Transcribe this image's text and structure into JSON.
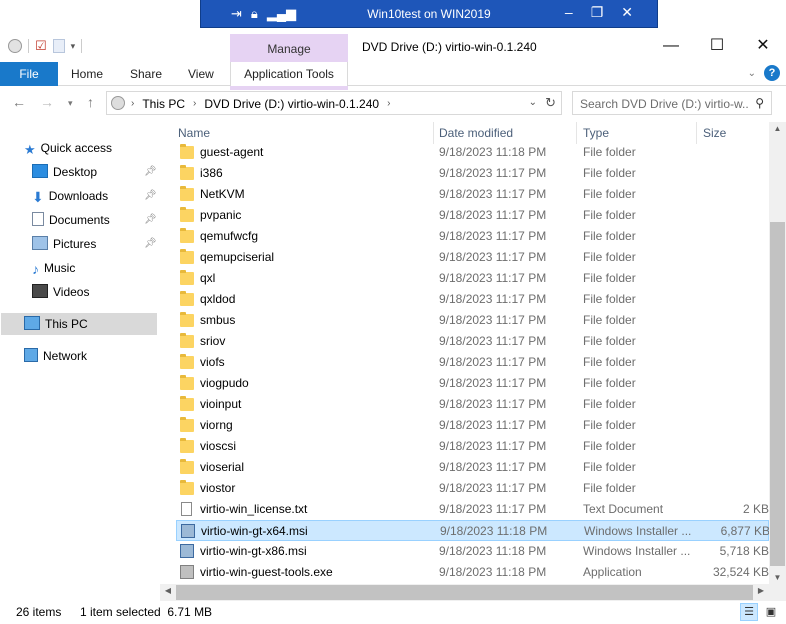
{
  "rdp": {
    "title": "Win10test on WIN2019",
    "icons": [
      "pin-icon",
      "lock-icon",
      "signal-icon"
    ],
    "controls": [
      "minimize-icon",
      "restore-icon",
      "close-icon"
    ]
  },
  "window": {
    "title": "DVD Drive (D:) virtio-win-0.1.240",
    "context_tab_group": "Manage",
    "controls": [
      "minimize-icon",
      "maximize-icon",
      "close-icon"
    ]
  },
  "ribbon": {
    "tabs": [
      "File",
      "Home",
      "Share",
      "View",
      "Application Tools"
    ],
    "help": "?",
    "file_color": "#1979ca",
    "manage_color": "#e6d3f3"
  },
  "address": {
    "crumbs": [
      "This PC",
      "DVD Drive (D:) virtio-win-0.1.240"
    ],
    "search_placeholder": "Search DVD Drive (D:) virtio-w..."
  },
  "nav": {
    "items": [
      {
        "label": "Quick access",
        "icon": "star-icon"
      },
      {
        "label": "Desktop",
        "icon": "desktop-icon",
        "pinned": true
      },
      {
        "label": "Downloads",
        "icon": "download-icon",
        "pinned": true
      },
      {
        "label": "Documents",
        "icon": "documents-icon",
        "pinned": true
      },
      {
        "label": "Pictures",
        "icon": "pictures-icon",
        "pinned": true
      },
      {
        "label": "Music",
        "icon": "music-icon"
      },
      {
        "label": "Videos",
        "icon": "videos-icon"
      },
      {
        "label": "This PC",
        "icon": "computer-icon",
        "selected": true
      },
      {
        "label": "Network",
        "icon": "network-icon"
      }
    ]
  },
  "columns": {
    "name": "Name",
    "date": "Date modified",
    "type": "Type",
    "size": "Size"
  },
  "files": [
    {
      "name": "guest-agent",
      "date": "9/18/2023 11:18 PM",
      "type": "File folder",
      "size": "",
      "icon": "folder"
    },
    {
      "name": "i386",
      "date": "9/18/2023 11:17 PM",
      "type": "File folder",
      "size": "",
      "icon": "folder"
    },
    {
      "name": "NetKVM",
      "date": "9/18/2023 11:17 PM",
      "type": "File folder",
      "size": "",
      "icon": "folder"
    },
    {
      "name": "pvpanic",
      "date": "9/18/2023 11:17 PM",
      "type": "File folder",
      "size": "",
      "icon": "folder"
    },
    {
      "name": "qemufwcfg",
      "date": "9/18/2023 11:17 PM",
      "type": "File folder",
      "size": "",
      "icon": "folder"
    },
    {
      "name": "qemupciserial",
      "date": "9/18/2023 11:17 PM",
      "type": "File folder",
      "size": "",
      "icon": "folder"
    },
    {
      "name": "qxl",
      "date": "9/18/2023 11:17 PM",
      "type": "File folder",
      "size": "",
      "icon": "folder"
    },
    {
      "name": "qxldod",
      "date": "9/18/2023 11:17 PM",
      "type": "File folder",
      "size": "",
      "icon": "folder"
    },
    {
      "name": "smbus",
      "date": "9/18/2023 11:17 PM",
      "type": "File folder",
      "size": "",
      "icon": "folder"
    },
    {
      "name": "sriov",
      "date": "9/18/2023 11:17 PM",
      "type": "File folder",
      "size": "",
      "icon": "folder"
    },
    {
      "name": "viofs",
      "date": "9/18/2023 11:17 PM",
      "type": "File folder",
      "size": "",
      "icon": "folder"
    },
    {
      "name": "viogpudo",
      "date": "9/18/2023 11:17 PM",
      "type": "File folder",
      "size": "",
      "icon": "folder"
    },
    {
      "name": "vioinput",
      "date": "9/18/2023 11:17 PM",
      "type": "File folder",
      "size": "",
      "icon": "folder"
    },
    {
      "name": "viorng",
      "date": "9/18/2023 11:17 PM",
      "type": "File folder",
      "size": "",
      "icon": "folder"
    },
    {
      "name": "vioscsi",
      "date": "9/18/2023 11:17 PM",
      "type": "File folder",
      "size": "",
      "icon": "folder"
    },
    {
      "name": "vioserial",
      "date": "9/18/2023 11:17 PM",
      "type": "File folder",
      "size": "",
      "icon": "folder"
    },
    {
      "name": "viostor",
      "date": "9/18/2023 11:17 PM",
      "type": "File folder",
      "size": "",
      "icon": "folder"
    },
    {
      "name": "virtio-win_license.txt",
      "date": "9/18/2023 11:17 PM",
      "type": "Text Document",
      "size": "2 KB",
      "icon": "txt"
    },
    {
      "name": "virtio-win-gt-x64.msi",
      "date": "9/18/2023 11:18 PM",
      "type": "Windows Installer ...",
      "size": "6,877 KB",
      "icon": "msi",
      "selected": true
    },
    {
      "name": "virtio-win-gt-x86.msi",
      "date": "9/18/2023 11:18 PM",
      "type": "Windows Installer ...",
      "size": "5,718 KB",
      "icon": "msi"
    },
    {
      "name": "virtio-win-guest-tools.exe",
      "date": "9/18/2023 11:18 PM",
      "type": "Application",
      "size": "32,524 KB",
      "icon": "exe"
    }
  ],
  "status": {
    "count": "26 items",
    "selection": "1 item selected  6.71 MB"
  }
}
